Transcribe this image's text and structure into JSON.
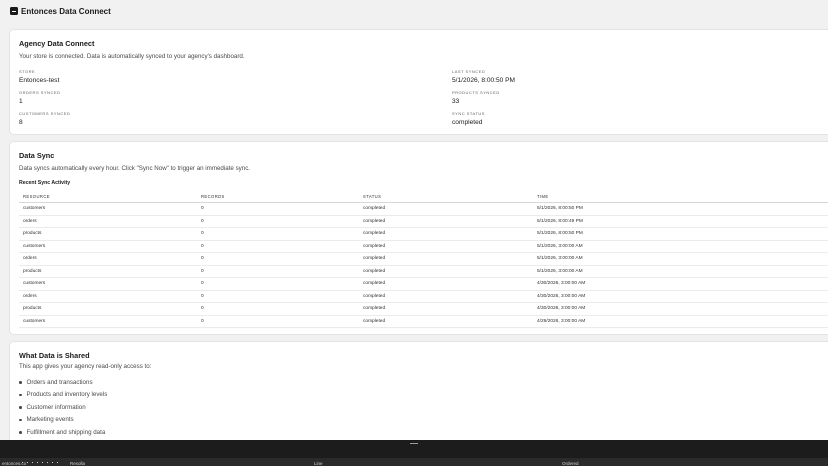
{
  "app": {
    "title": "Entonces Data Connect"
  },
  "agency": {
    "title": "Agency Data Connect",
    "description": "Your store is connected. Data is automatically synced to your agency's dashboard.",
    "stats": {
      "store": {
        "label": "STORE",
        "value": "Entonces-test"
      },
      "last_synced": {
        "label": "LAST SYNCED",
        "value": "5/1/2026, 8:00:50 PM"
      },
      "orders_synced": {
        "label": "ORDERS SYNCED",
        "value": "1"
      },
      "products_synced": {
        "label": "PRODUCTS SYNCED",
        "value": "33"
      },
      "customers_synced": {
        "label": "CUSTOMERS SYNCED",
        "value": "8"
      },
      "sync_status": {
        "label": "SYNC STATUS",
        "value": "completed"
      }
    }
  },
  "sync": {
    "title": "Data Sync",
    "description": "Data syncs automatically every hour. Click \"Sync Now\" to trigger an immediate sync.",
    "activity_title": "Recent Sync Activity",
    "columns": [
      "RESOURCE",
      "RECORDS",
      "STATUS",
      "TIME"
    ],
    "rows": [
      [
        "customers",
        "0",
        "completed",
        "5/1/2026, 8:00:50 PM"
      ],
      [
        "orders",
        "0",
        "completed",
        "5/1/2026, 8:00:49 PM"
      ],
      [
        "products",
        "0",
        "completed",
        "5/1/2026, 8:00:50 PM"
      ],
      [
        "customers",
        "0",
        "completed",
        "5/1/2026, 3:00:00 AM"
      ],
      [
        "orders",
        "0",
        "completed",
        "5/1/2026, 3:00:00 AM"
      ],
      [
        "products",
        "0",
        "completed",
        "5/1/2026, 3:00:00 AM"
      ],
      [
        "customers",
        "0",
        "completed",
        "4/30/2026, 3:00:00 AM"
      ],
      [
        "orders",
        "0",
        "completed",
        "4/30/2026, 3:00:00 AM"
      ],
      [
        "products",
        "0",
        "completed",
        "4/30/2026, 3:00:00 AM"
      ],
      [
        "customers",
        "0",
        "completed",
        "4/29/2026, 3:00:00 AM"
      ]
    ]
  },
  "shared": {
    "title": "What Data is Shared",
    "description": "This app gives your agency read-only access to:",
    "items": [
      "Orders and transactions",
      "Products and inventory levels",
      "Customer information",
      "Marketing events",
      "Fulfillment and shipping data"
    ]
  },
  "bottom": {
    "left": "entonces.co",
    "col1": "Resolla",
    "col2": "Line",
    "col3": "Ordered"
  }
}
